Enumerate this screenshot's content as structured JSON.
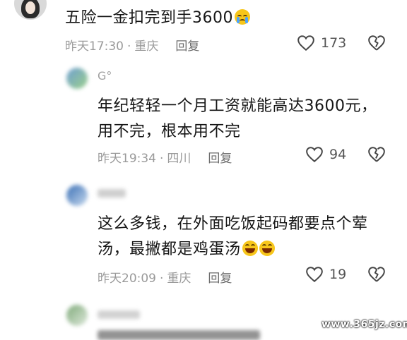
{
  "comments": [
    {
      "text": "五险一金扣完到手3600",
      "emoji": "crying-face",
      "time": "昨天17:30",
      "location": "重庆",
      "reply": "回复",
      "likes": "173"
    },
    {
      "username": "G°",
      "text_line1": "年纪轻轻一个月工资就能高达3600元，",
      "text_line2": "用不完，根本用不完",
      "time": "昨天19:34",
      "location": "四川",
      "reply": "回复",
      "likes": "94"
    },
    {
      "text_line1": "这么多钱，在外面吃饭起码都要点个荤",
      "text_line2": "汤，最撇都是鸡蛋汤",
      "emoji": "laughing-face",
      "time": "昨天20:09",
      "location": "重庆",
      "reply": "回复",
      "likes": "19"
    }
  ],
  "watermark": "www.365jz.com"
}
